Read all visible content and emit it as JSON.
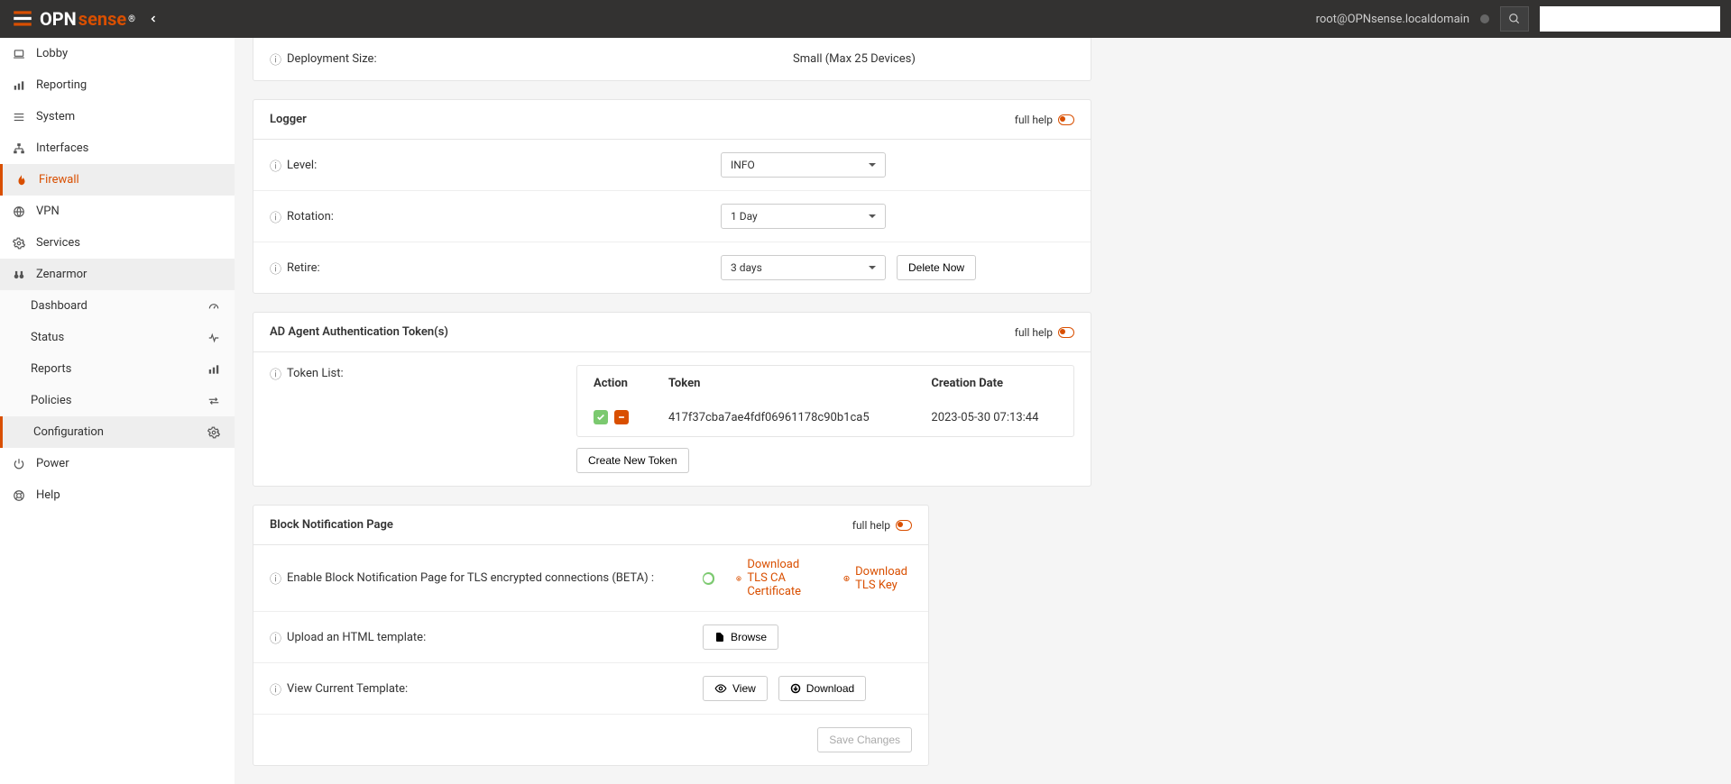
{
  "header": {
    "logo_text1": "OPN",
    "logo_text2": "sense",
    "user": "root@OPNsense.localdomain",
    "search_placeholder": ""
  },
  "sidebar": {
    "items": [
      {
        "label": "Lobby",
        "icon": "laptop"
      },
      {
        "label": "Reporting",
        "icon": "chart"
      },
      {
        "label": "System",
        "icon": "gear"
      },
      {
        "label": "Interfaces",
        "icon": "sitemap"
      },
      {
        "label": "Firewall",
        "icon": "fire",
        "active": true
      },
      {
        "label": "VPN",
        "icon": "globe"
      },
      {
        "label": "Services",
        "icon": "cog"
      },
      {
        "label": "Zenarmor",
        "icon": "binoculars",
        "expanded": true
      }
    ],
    "subitems": [
      {
        "label": "Dashboard",
        "icon": "tachometer"
      },
      {
        "label": "Status",
        "icon": "heartbeat"
      },
      {
        "label": "Reports",
        "icon": "chart"
      },
      {
        "label": "Policies",
        "icon": "exchange"
      },
      {
        "label": "Configuration",
        "icon": "cog",
        "active": true
      }
    ],
    "bottom": [
      {
        "label": "Power",
        "icon": "power"
      },
      {
        "label": "Help",
        "icon": "life-ring"
      }
    ]
  },
  "deployment": {
    "label": "Deployment Size:",
    "value": "Small (Max 25 Devices)"
  },
  "logger": {
    "title": "Logger",
    "full_help": "full help",
    "level_label": "Level:",
    "level_value": "INFO",
    "rotation_label": "Rotation:",
    "rotation_value": "1 Day",
    "retire_label": "Retire:",
    "retire_value": "3 days",
    "delete_now": "Delete Now"
  },
  "tokens": {
    "title": "AD Agent Authentication Token(s)",
    "full_help": "full help",
    "list_label": "Token List:",
    "headers": {
      "action": "Action",
      "token": "Token",
      "date": "Creation Date"
    },
    "rows": [
      {
        "token": "417f37cba7ae4fdf06961178c90b1ca5",
        "date": "2023-05-30 07:13:44"
      }
    ],
    "create_btn": "Create New Token"
  },
  "block": {
    "title": "Block Notification Page",
    "full_help": "full help",
    "enable_label": "Enable Block Notification Page for TLS encrypted connections (BETA) :",
    "download_ca": "Download TLS CA Certificate",
    "download_key": "Download TLS Key",
    "upload_label": "Upload an HTML template:",
    "browse": "Browse",
    "view_label": "View Current Template:",
    "view_btn": "View",
    "download_btn": "Download",
    "save": "Save Changes"
  }
}
